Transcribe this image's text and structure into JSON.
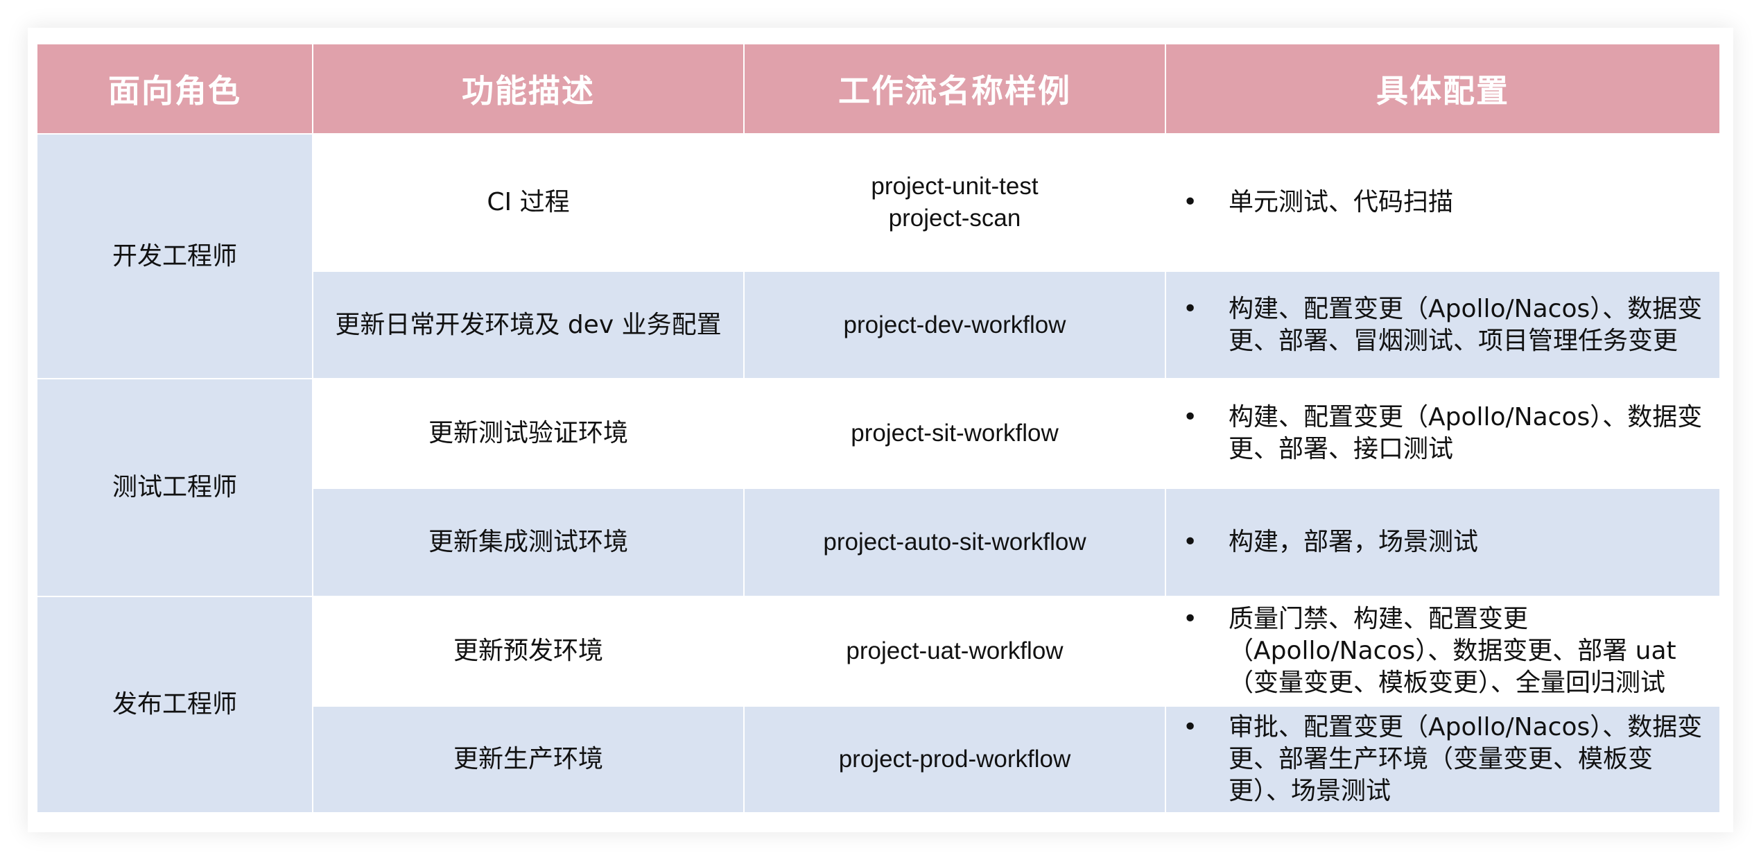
{
  "headers": [
    "面向角色",
    "功能描述",
    "工作流名称样例",
    "具体配置"
  ],
  "roles": [
    "开发工程师",
    "测试工程师",
    "发布工程师"
  ],
  "rows": [
    {
      "func": "CI 过程",
      "workflow": [
        "project-unit-test",
        "project-scan"
      ],
      "bullet": "•",
      "config": "单元测试、代码扫描"
    },
    {
      "func": "更新日常开发环境及 dev 业务配置",
      "workflow": [
        "project-dev-workflow"
      ],
      "bullet": "•",
      "config": "构建、配置变更（Apollo/Nacos）、数据变更、部署、冒烟测试、项目管理任务变更"
    },
    {
      "func": "更新测试验证环境",
      "workflow": [
        "project-sit-workflow"
      ],
      "bullet": "•",
      "config": "构建、配置变更（Apollo/Nacos）、数据变更、部署、接口测试"
    },
    {
      "func": "更新集成测试环境",
      "workflow": [
        "project-auto-sit-workflow"
      ],
      "bullet": "•",
      "config": "构建，部署，场景测试"
    },
    {
      "func": "更新预发环境",
      "workflow": [
        "project-uat-workflow"
      ],
      "bullet": "•",
      "config": "质量门禁、构建、配置变更（Apollo/Nacos）、数据变更、部署 uat（变量变更、模板变更）、全量回归测试"
    },
    {
      "func": "更新生产环境",
      "workflow": [
        "project-prod-workflow"
      ],
      "bullet": "•",
      "config": "审批、配置变更（Apollo/Nacos）、数据变更、部署生产环境（变量变更、模板变更）、场景测试"
    }
  ],
  "colors": {
    "header_bg": "#e0a1ab",
    "row_blue": "#d9e2f1",
    "row_white": "#ffffff"
  }
}
